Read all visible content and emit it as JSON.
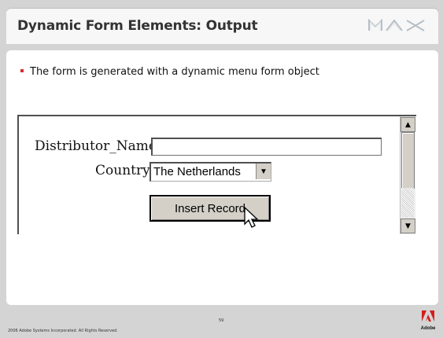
{
  "slide": {
    "title": "Dynamic Form Elements: Output",
    "bullet": "The form is generated with a dynamic menu form object",
    "page_number": "59",
    "footer": "2006 Adobe Systems Incorporated.  All Rights Reserved.",
    "adobe_logo_text": "Adobe"
  },
  "form": {
    "distributor_label": "Distributor_Name:",
    "distributor_value": "",
    "country_label": "Country:",
    "country_value": "The Netherlands",
    "submit_label": "Insert Record"
  },
  "colors": {
    "bullet_accent": "#e02a2a",
    "adobe_red": "#d51c1c"
  }
}
